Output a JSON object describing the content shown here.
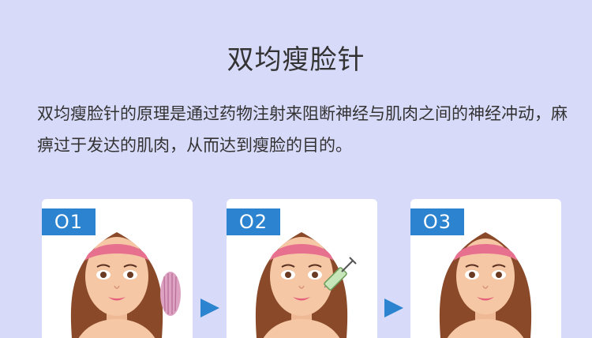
{
  "title": "双均瘦脸针",
  "description": "双均瘦脸针的原理是通过药物注射来阻断神经与肌肉之间的神经冲动，麻痹过于发达的肌肉，从而达到瘦脸的目的。",
  "steps": [
    {
      "label": "O1",
      "extra": "muscle-icon"
    },
    {
      "label": "O2",
      "extra": "syringe-icon"
    },
    {
      "label": "O3",
      "extra": "none"
    }
  ],
  "colors": {
    "background": "#d8dafa",
    "accent": "#2c84d0",
    "card": "#ffffff",
    "hair": "#8a4a2a",
    "skin": "#f5c7a4",
    "headband": "#e8708f"
  }
}
